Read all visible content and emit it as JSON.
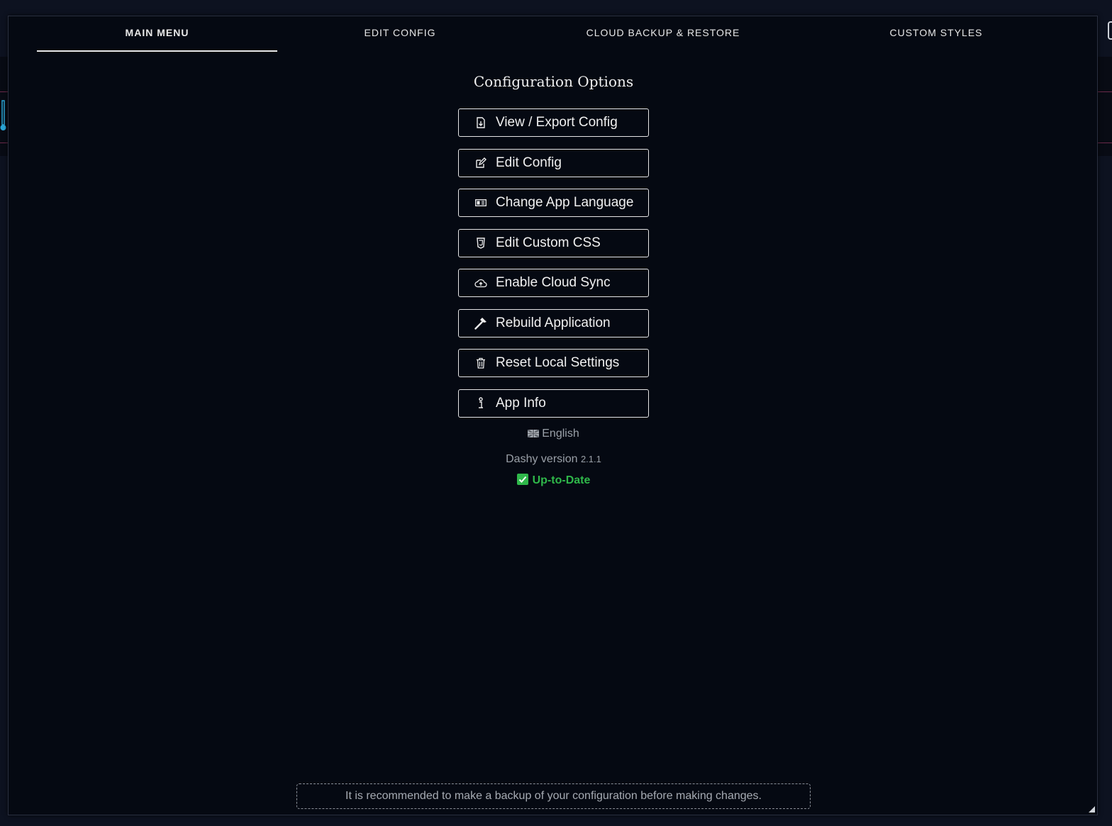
{
  "tabs": [
    {
      "label": "MAIN MENU",
      "active": true
    },
    {
      "label": "EDIT CONFIG",
      "active": false
    },
    {
      "label": "CLOUD BACKUP & RESTORE",
      "active": false
    },
    {
      "label": "CUSTOM STYLES",
      "active": false
    }
  ],
  "main": {
    "title": "Configuration Options",
    "buttons": [
      {
        "label": "View / Export Config",
        "icon": "export-file-icon"
      },
      {
        "label": "Edit Config",
        "icon": "edit-icon"
      },
      {
        "label": "Change App Language",
        "icon": "language-icon"
      },
      {
        "label": "Edit Custom CSS",
        "icon": "css-icon"
      },
      {
        "label": "Enable Cloud Sync",
        "icon": "cloud-upload-icon"
      },
      {
        "label": "Rebuild Application",
        "icon": "hammer-icon"
      },
      {
        "label": "Reset Local Settings",
        "icon": "trash-icon"
      },
      {
        "label": "App Info",
        "icon": "info-icon"
      }
    ],
    "language": "English",
    "version_label": "Dashy version",
    "version_number": "2.1.1",
    "update_status": "Up-to-Date"
  },
  "footer": {
    "notice": "It is recommended to make a backup of your configuration before making changes."
  },
  "colors": {
    "background": "#050912",
    "text": "#f0f0f0",
    "status_ok": "#2fb84a",
    "muted": "#9aa0a8"
  }
}
